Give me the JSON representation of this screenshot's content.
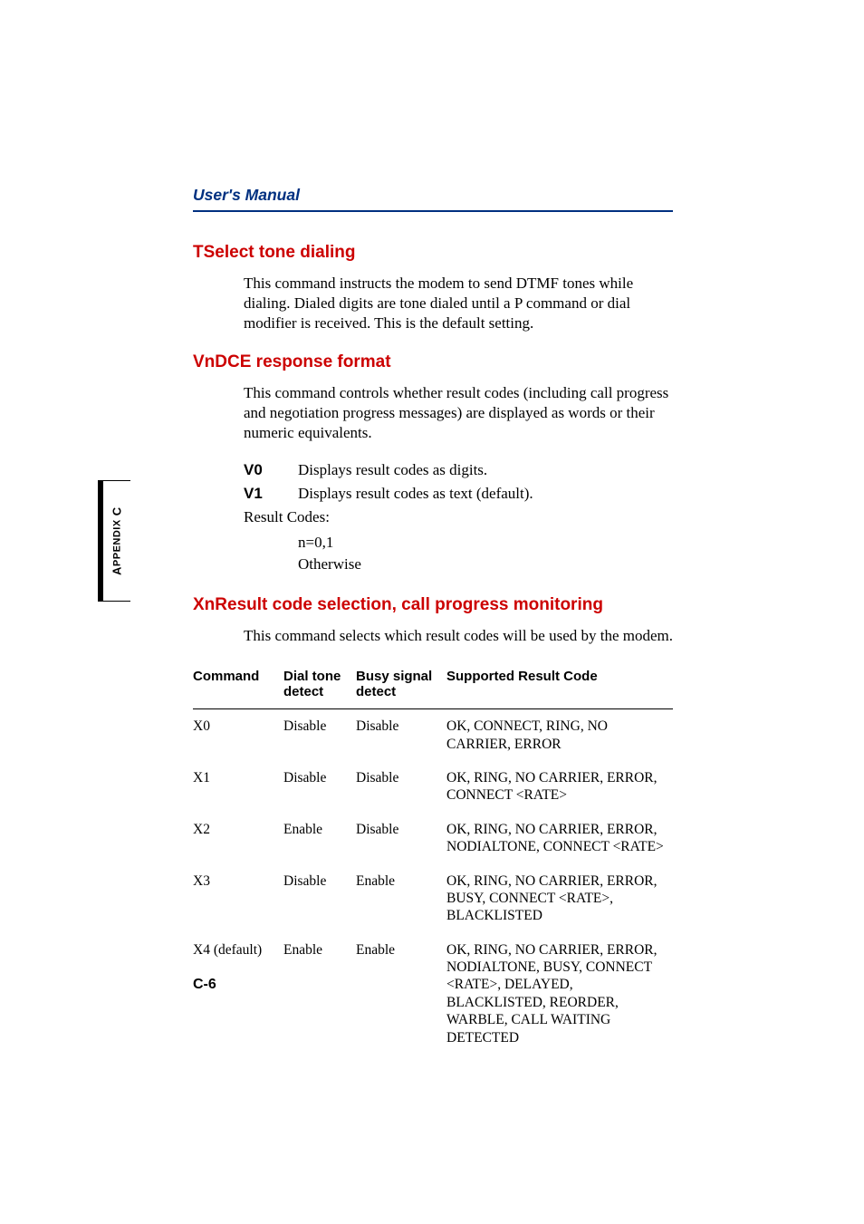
{
  "header": {
    "title": "User's Manual"
  },
  "sidebar": {
    "label_main": "A",
    "label_rest": "PPENDIX",
    "label_suffix": " C"
  },
  "page_number": "C-6",
  "sections": {
    "t": {
      "heading": "TSelect tone dialing",
      "body": "This command instructs the modem to send DTMF tones while dialing. Dialed digits are tone dialed until a P command or dial modifier is received. This is the default setting."
    },
    "vn": {
      "heading": "VnDCE response format",
      "body": "This command controls whether result codes (including call progress and negotiation progress messages) are displayed as words or their numeric equivalents.",
      "items": [
        {
          "term": "V0",
          "desc": "Displays result codes as digits."
        },
        {
          "term": "V1",
          "desc": "Displays result codes as text (default)."
        }
      ],
      "result_label": "Result Codes:",
      "result_items": [
        "n=0,1",
        "Otherwise"
      ]
    },
    "xn": {
      "heading": "XnResult code selection, call progress monitoring",
      "body": "This command selects which result codes will be used by the modem."
    }
  },
  "table": {
    "headers": {
      "cmd": "Command",
      "dial": "Dial tone detect",
      "busy": "Busy signal detect",
      "result": "Supported Result Code"
    },
    "rows": [
      {
        "cmd": "X0",
        "dial": "Disable",
        "busy": "Disable",
        "result": "OK, CONNECT, RING, NO CARRIER, ERROR"
      },
      {
        "cmd": "X1",
        "dial": "Disable",
        "busy": "Disable",
        "result": "OK, RING, NO CARRIER, ERROR, CONNECT <RATE>"
      },
      {
        "cmd": "X2",
        "dial": "Enable",
        "busy": "Disable",
        "result": "OK, RING, NO CARRIER, ERROR, NODIALTONE, CONNECT <RATE>"
      },
      {
        "cmd": "X3",
        "dial": "Disable",
        "busy": "Enable",
        "result": "OK, RING, NO CARRIER, ERROR, BUSY, CONNECT <RATE>, BLACKLISTED"
      },
      {
        "cmd": "X4 (default)",
        "dial": "Enable",
        "busy": "Enable",
        "result": "OK, RING, NO CARRIER, ERROR, NODIALTONE, BUSY, CONNECT <RATE>, DELAYED, BLACKLISTED, REORDER, WARBLE, CALL WAITING DETECTED"
      }
    ]
  }
}
